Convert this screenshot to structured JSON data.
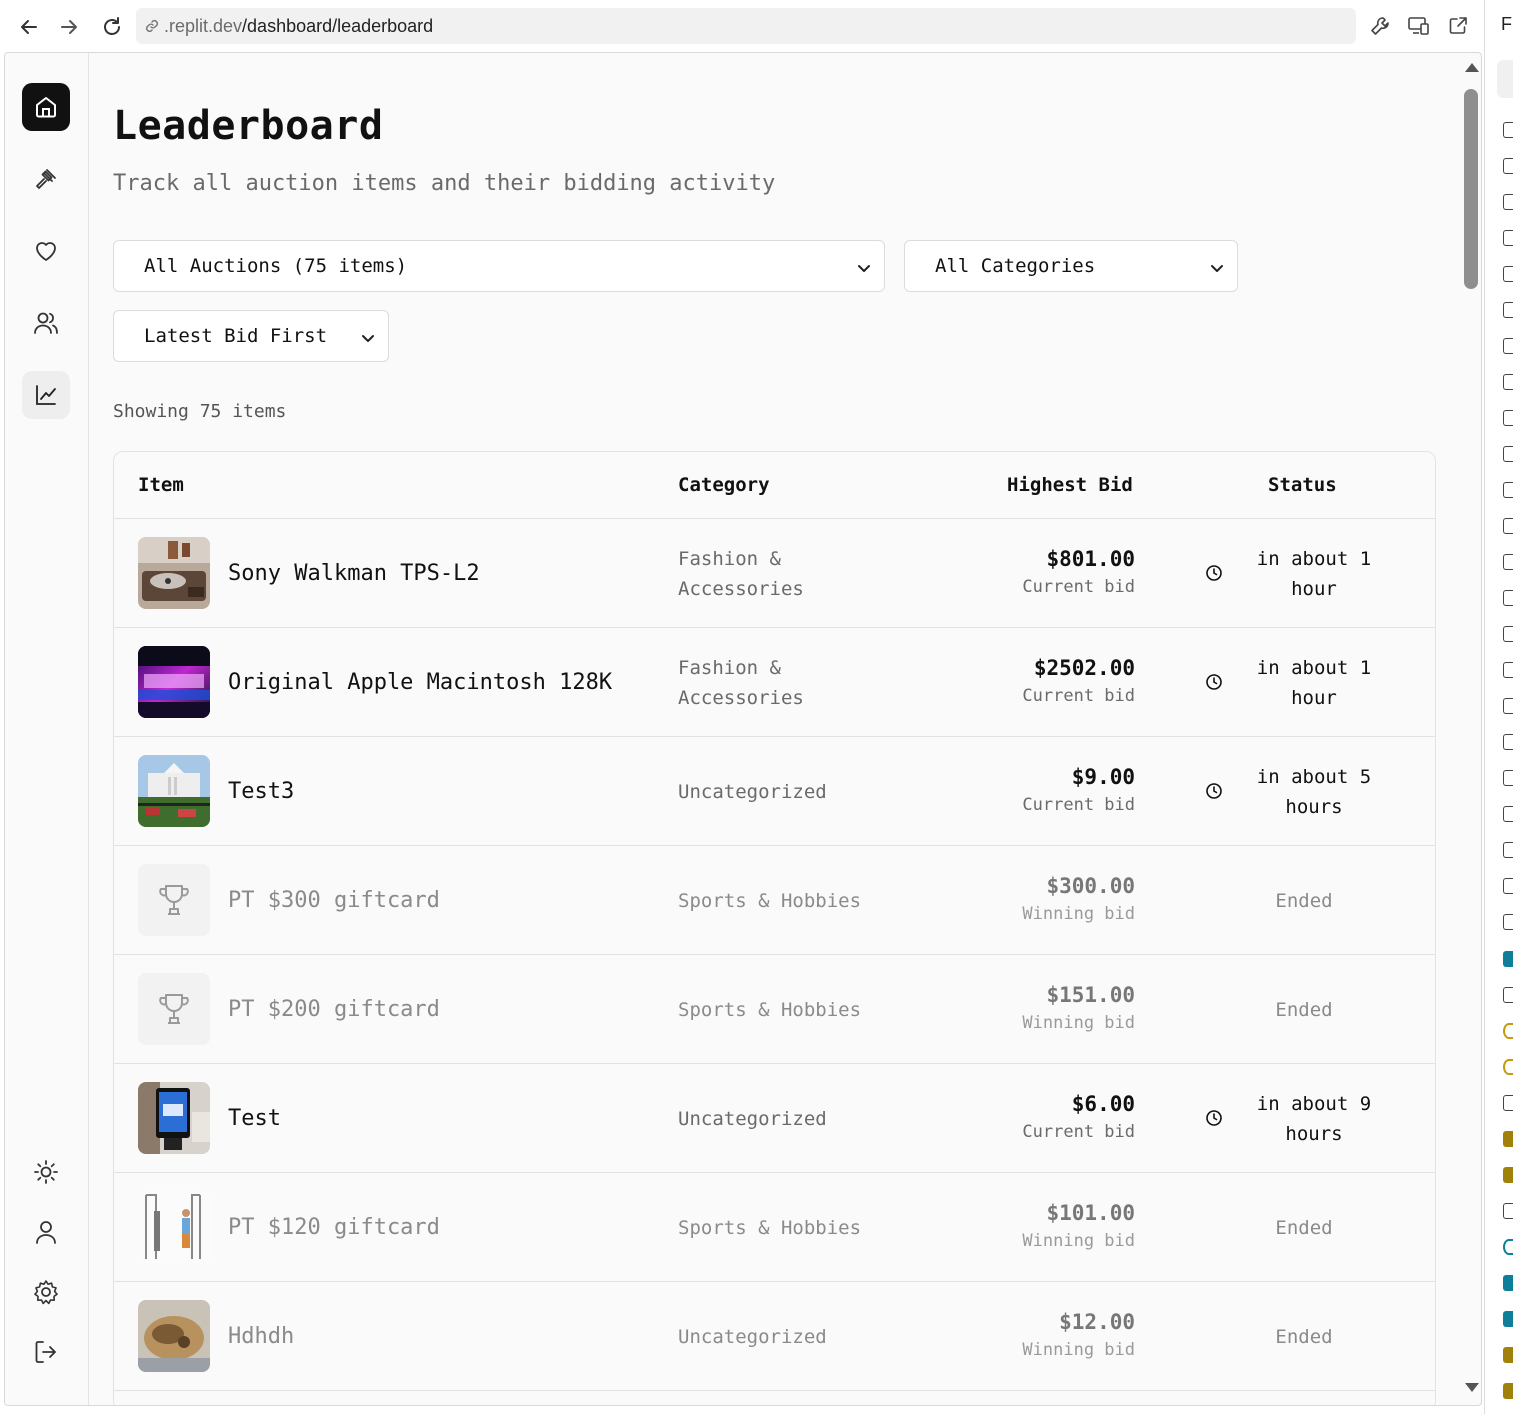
{
  "browser": {
    "url_host": ".replit.dev",
    "url_path": "/dashboard/leaderboard",
    "side_letter": "F"
  },
  "icons": {
    "nav": [
      "back-arrow-icon",
      "forward-arrow-icon",
      "reload-icon",
      "link-icon"
    ],
    "tools": [
      "wrench-icon",
      "devices-icon",
      "external-link-icon"
    ],
    "sidebar": [
      "home-icon",
      "gavel-icon",
      "heart-icon",
      "users-icon",
      "chart-icon",
      "sun-icon",
      "user-icon",
      "gear-icon",
      "logout-icon"
    ]
  },
  "page": {
    "title": "Leaderboard",
    "subtitle": "Track all auction items and their bidding activity"
  },
  "filters": {
    "auctions": "All Auctions (75 items)",
    "categories": "All Categories",
    "sort": "Latest Bid First"
  },
  "showing": "Showing 75 items",
  "table": {
    "headers": [
      "Item",
      "Category",
      "Highest Bid",
      "Status"
    ],
    "rows": [
      {
        "name": "Sony Walkman TPS-L2",
        "category": "Fashion & Accessories",
        "amount": "$801.00",
        "bid_label": "Current bid",
        "status": "in about 1 hour",
        "ended": false
      },
      {
        "name": "Original Apple Macintosh 128K",
        "category": "Fashion & Accessories",
        "amount": "$2502.00",
        "bid_label": "Current bid",
        "status": "in about 1 hour",
        "ended": false
      },
      {
        "name": "Test3",
        "category": "Uncategorized",
        "amount": "$9.00",
        "bid_label": "Current bid",
        "status": "in about 5 hours",
        "ended": false
      },
      {
        "name": "PT $300 giftcard",
        "category": "Sports & Hobbies",
        "amount": "$300.00",
        "bid_label": "Winning bid",
        "status": "Ended",
        "ended": true
      },
      {
        "name": "PT $200 giftcard",
        "category": "Sports & Hobbies",
        "amount": "$151.00",
        "bid_label": "Winning bid",
        "status": "Ended",
        "ended": true
      },
      {
        "name": "Test",
        "category": "Uncategorized",
        "amount": "$6.00",
        "bid_label": "Current bid",
        "status": "in about 9 hours",
        "ended": false
      },
      {
        "name": "PT $120 giftcard",
        "category": "Sports & Hobbies",
        "amount": "$101.00",
        "bid_label": "Winning bid",
        "status": "Ended",
        "ended": true
      },
      {
        "name": "Hdhdh",
        "category": "Uncategorized",
        "amount": "$12.00",
        "bid_label": "Winning bid",
        "status": "Ended",
        "ended": true
      }
    ]
  }
}
